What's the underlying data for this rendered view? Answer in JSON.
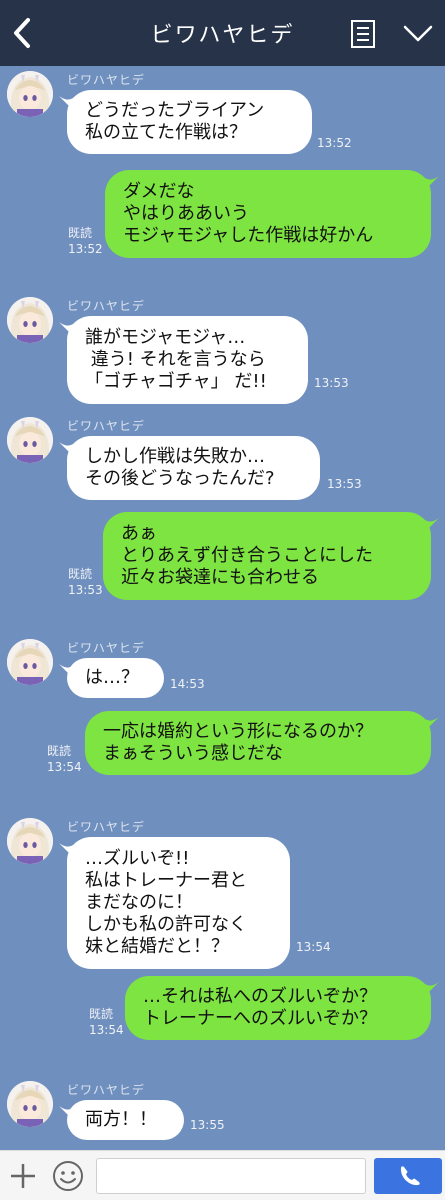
{
  "header": {
    "title": "ビワハヤヒデ",
    "back_icon": "chevron-left-icon",
    "menu_icon": "list-icon",
    "down_icon": "chevron-down-icon",
    "background": "#273349"
  },
  "chat": {
    "background": "#6f8fbf",
    "incoming_bubble_color": "#ffffff",
    "outgoing_bubble_color": "#7ee441",
    "messages": [
      {
        "dir": "in",
        "sender": "ビワハヤヒデ",
        "lines": [
          "どうだったブライアン",
          "私の立てた作戦は？"
        ],
        "time": "13:52"
      },
      {
        "dir": "out",
        "read": "既読",
        "lines": [
          "ダメだな",
          "やはりああいう",
          "モジャモジャした作戦は好かん"
        ],
        "time": "13:52"
      },
      {
        "dir": "in",
        "sender": "ビワハヤヒデ",
        "lines": [
          "誰がモジャモジャ…",
          " 違う! それを言うなら",
          "「ゴチャゴチャ」 だ!!"
        ],
        "time": "13:53"
      },
      {
        "dir": "in",
        "sender": "ビワハヤヒデ",
        "lines": [
          "しかし作戦は失敗か…",
          "その後どうなったんだ?"
        ],
        "time": "13:53"
      },
      {
        "dir": "out",
        "read": "既読",
        "lines": [
          "あぁ",
          "とりあえず付き合うことにした",
          "近々お袋達にも合わせる"
        ],
        "time": "13:53"
      },
      {
        "dir": "in",
        "sender": "ビワハヤヒデ",
        "lines": [
          "は…？"
        ],
        "time": "14:53"
      },
      {
        "dir": "out",
        "read": "既読",
        "lines": [
          "一応は婚約という形になるのか？",
          "まぁそういう感じだな"
        ],
        "time": "13:54"
      },
      {
        "dir": "in",
        "sender": "ビワハヤヒデ",
        "lines": [
          "…ズルいぞ!!",
          "私はトレーナー君と",
          "まだなのに！",
          "しかも私の許可なく",
          "妹と結婚だと！？"
        ],
        "time": "13:54"
      },
      {
        "dir": "out",
        "read": "既読",
        "lines": [
          "…それは私へのズルいぞか？",
          "トレーナーへのズルいぞか？"
        ],
        "time": "13:54"
      },
      {
        "dir": "in",
        "sender": "ビワハヤヒデ",
        "lines": [
          "両方！！"
        ],
        "time": "13:55"
      }
    ]
  },
  "input_bar": {
    "plus_icon": "plus-icon",
    "emoji_icon": "smiley-icon",
    "placeholder": "",
    "call_icon": "phone-icon",
    "call_color": "#3b74e0"
  }
}
